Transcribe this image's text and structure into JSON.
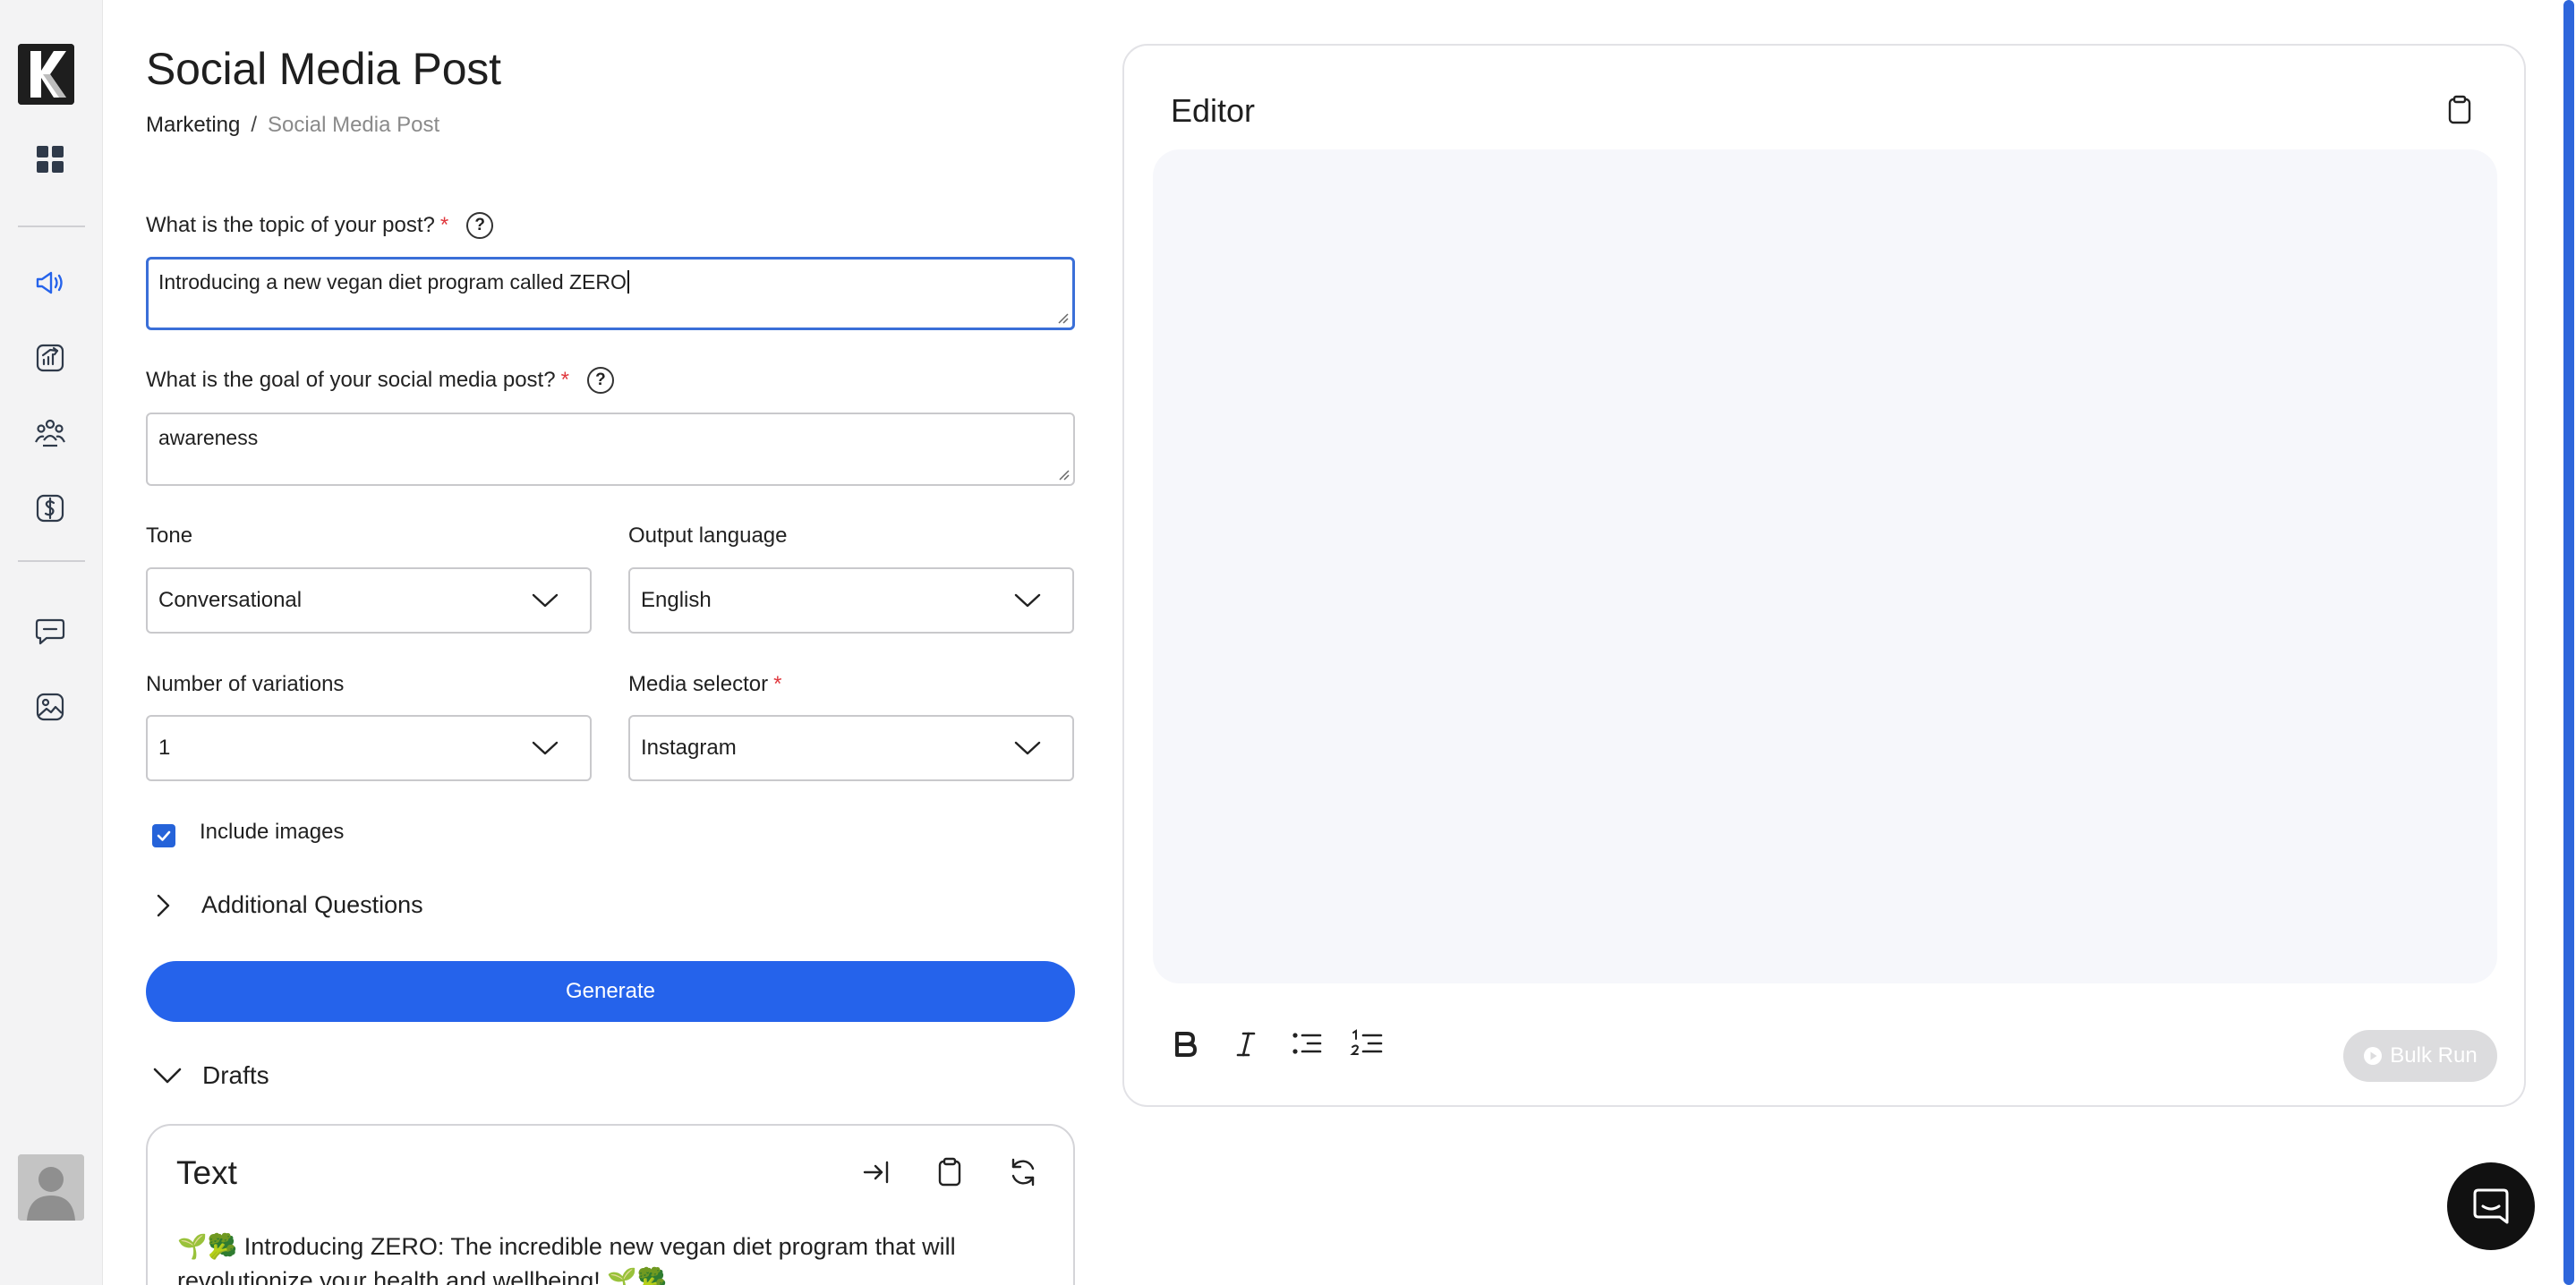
{
  "page": {
    "title": "Social Media Post",
    "breadcrumb": {
      "parent": "Marketing",
      "separator": "/",
      "current": "Social Media Post"
    }
  },
  "sidebar": {
    "logo_letter": "K",
    "items": [
      {
        "name": "dashboard",
        "icon": "grid-icon"
      },
      {
        "name": "marketing",
        "icon": "megaphone-icon",
        "active": true
      },
      {
        "name": "analytics",
        "icon": "chart-icon"
      },
      {
        "name": "team",
        "icon": "people-icon"
      },
      {
        "name": "finance",
        "icon": "dollar-icon"
      },
      {
        "name": "chat",
        "icon": "chat-icon"
      },
      {
        "name": "images",
        "icon": "image-icon"
      }
    ]
  },
  "form": {
    "topic": {
      "label": "What is the topic of your post?",
      "required": "*",
      "help": "?",
      "value": "Introducing a new vegan diet program called ZERO"
    },
    "goal": {
      "label": "What is the goal of your social media post?",
      "required": "*",
      "help": "?",
      "value": "awareness"
    },
    "tone": {
      "label": "Tone",
      "value": "Conversational"
    },
    "language": {
      "label": "Output language",
      "value": "English"
    },
    "variations": {
      "label": "Number of variations",
      "value": "1"
    },
    "media": {
      "label": "Media selector",
      "required": "*",
      "value": "Instagram"
    },
    "include_images": {
      "label": "Include images",
      "checked": true
    },
    "additional_questions": "Additional Questions",
    "generate_label": "Generate"
  },
  "drafts": {
    "label": "Drafts",
    "card": {
      "title": "Text",
      "text": "🌱🥦 Introducing ZERO: The incredible new vegan diet program that will revolutionize your health and wellbeing! 🌱🥦"
    }
  },
  "editor": {
    "title": "Editor",
    "bulk_run_label": "Bulk Run"
  },
  "colors": {
    "accent": "#2563eb",
    "required": "#e0383e",
    "sidebar_bg": "#f3f3f4",
    "editor_bg": "#f6f7fb"
  }
}
